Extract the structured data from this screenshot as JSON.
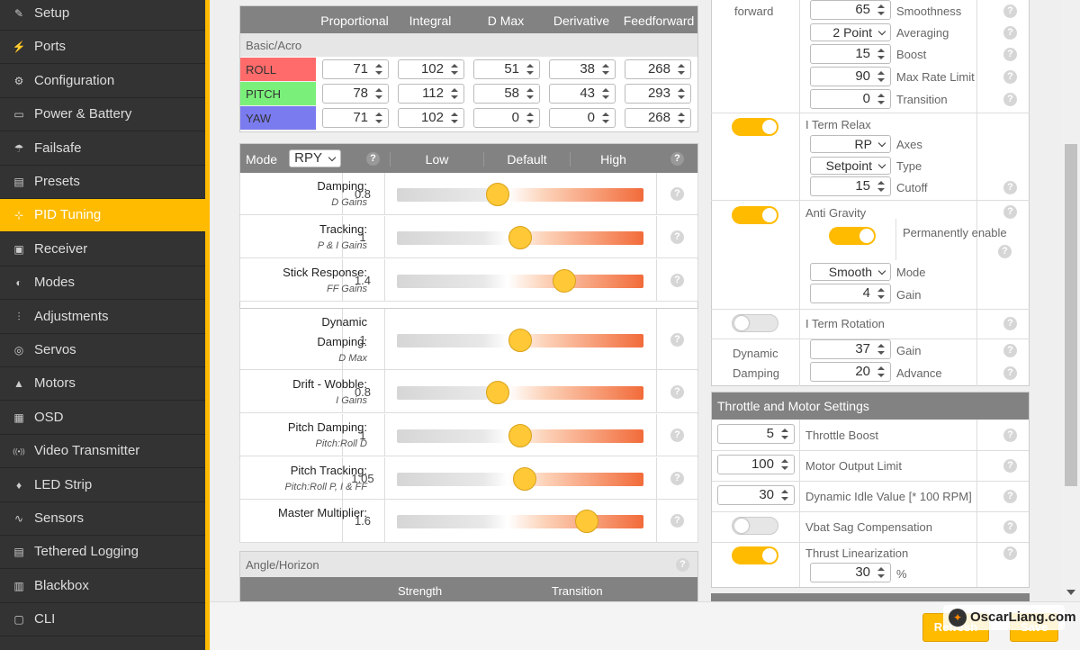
{
  "nav": [
    {
      "label": "Setup",
      "icon": "wrench-icon",
      "glyph": "✎"
    },
    {
      "label": "Ports",
      "icon": "plug-icon",
      "glyph": "⚡"
    },
    {
      "label": "Configuration",
      "icon": "gear-icon",
      "glyph": "⚙"
    },
    {
      "label": "Power & Battery",
      "icon": "battery-icon",
      "glyph": "▭"
    },
    {
      "label": "Failsafe",
      "icon": "parachute-icon",
      "glyph": "☂"
    },
    {
      "label": "Presets",
      "icon": "presets-icon",
      "glyph": "▤"
    },
    {
      "label": "PID Tuning",
      "icon": "pid-icon",
      "glyph": "⊹"
    },
    {
      "label": "Receiver",
      "icon": "receiver-icon",
      "glyph": "▣"
    },
    {
      "label": "Modes",
      "icon": "modes-icon",
      "glyph": "◐"
    },
    {
      "label": "Adjustments",
      "icon": "sliders-icon",
      "glyph": "⫶"
    },
    {
      "label": "Servos",
      "icon": "servo-icon",
      "glyph": "◎"
    },
    {
      "label": "Motors",
      "icon": "motor-icon",
      "glyph": "▲"
    },
    {
      "label": "OSD",
      "icon": "osd-icon",
      "glyph": "▦"
    },
    {
      "label": "Video Transmitter",
      "icon": "vtx-icon",
      "glyph": "((•))"
    },
    {
      "label": "LED Strip",
      "icon": "led-icon",
      "glyph": "♦"
    },
    {
      "label": "Sensors",
      "icon": "sensors-icon",
      "glyph": "∿"
    },
    {
      "label": "Tethered Logging",
      "icon": "logging-icon",
      "glyph": "▤"
    },
    {
      "label": "Blackbox",
      "icon": "blackbox-icon",
      "glyph": "▥"
    },
    {
      "label": "CLI",
      "icon": "cli-icon",
      "glyph": "▢"
    }
  ],
  "pid_table": {
    "headers": [
      "Proportional",
      "Integral",
      "D Max",
      "Derivative",
      "Feedforward"
    ],
    "section": "Basic/Acro",
    "rows": [
      {
        "axis": "ROLL",
        "color": "#ff6b6b",
        "values": [
          "71",
          "102",
          "51",
          "38",
          "268"
        ]
      },
      {
        "axis": "PITCH",
        "color": "#7af07a",
        "values": [
          "78",
          "112",
          "58",
          "43",
          "293"
        ]
      },
      {
        "axis": "YAW",
        "color": "#7b7bf0",
        "values": [
          "71",
          "102",
          "0",
          "0",
          "268"
        ]
      }
    ]
  },
  "slider_header": {
    "mode_label": "Mode",
    "mode_value": "RPY",
    "low": "Low",
    "default": "Default",
    "high": "High"
  },
  "sliders": [
    {
      "label": "Damping:",
      "sub": "D Gains",
      "value": "0.8",
      "level": 0.41
    },
    {
      "label": "Tracking:",
      "sub": "P & I Gains",
      "value": "1",
      "level": 0.5
    },
    {
      "label": "Stick Response:",
      "sub": "FF Gains",
      "value": "1.4",
      "level": 0.68
    },
    {
      "label": "Dynamic Damping:",
      "sub": "D Max",
      "value": "1",
      "level": 0.5
    },
    {
      "label": "Drift - Wobble:",
      "sub": "I Gains",
      "value": "0.8",
      "level": 0.41
    },
    {
      "label": "Pitch Damping:",
      "sub": "Pitch:Roll D",
      "value": "1",
      "level": 0.5
    },
    {
      "label": "Pitch Tracking:",
      "sub": "Pitch:Roll P, I & FF",
      "value": "1.05",
      "level": 0.52
    },
    {
      "label": "Master Multiplier:",
      "sub": "",
      "value": "1.6",
      "level": 0.77
    }
  ],
  "angle": {
    "title": "Angle/Horizon",
    "cols": [
      "Strength",
      "Transition"
    ]
  },
  "right": {
    "ff": {
      "label": "forward",
      "smoothness": "65",
      "smoothness_label": "Smoothness",
      "averaging": "2 Point",
      "averaging_label": "Averaging",
      "boost": "15",
      "boost_label": "Boost",
      "max_rate": "90",
      "max_rate_label": "Max Rate Limit",
      "transition": "0",
      "transition_label": "Transition"
    },
    "iterm_relax": {
      "label": "I Term Relax",
      "axes": "RP",
      "axes_label": "Axes",
      "type": "Setpoint",
      "type_label": "Type",
      "cutoff": "15",
      "cutoff_label": "Cutoff"
    },
    "anti_gravity": {
      "label": "Anti Gravity",
      "perm_label": "Permanently enable",
      "mode": "Smooth",
      "mode_label": "Mode",
      "gain": "4",
      "gain_label": "Gain"
    },
    "iterm_rotation": {
      "label": "I Term Rotation"
    },
    "dyn_damping": {
      "label1": "Dynamic",
      "label2": "Damping",
      "gain": "37",
      "gain_label": "Gain",
      "advance": "20",
      "advance_label": "Advance"
    }
  },
  "throttle": {
    "title": "Throttle and Motor Settings",
    "boost": "5",
    "boost_label": "Throttle Boost",
    "motor_limit": "100",
    "motor_limit_label": "Motor Output Limit",
    "idle": "30",
    "idle_label": "Dynamic Idle Value [* 100 RPM]",
    "vbat_label": "Vbat Sag Compensation",
    "thrust_label": "Thrust Linearization",
    "thrust": "30",
    "thrust_unit": "%"
  },
  "buttons": {
    "refresh": "Refresh",
    "save": "Save"
  },
  "watermark": "OscarLiang.com"
}
